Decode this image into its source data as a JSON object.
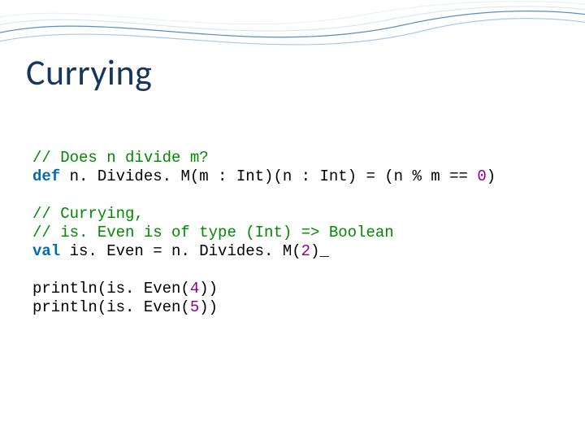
{
  "slide": {
    "title": "Currying",
    "code": {
      "c1_comment": "// Does n divide m?",
      "c1_def": "def",
      "c1_name": " n. Divides. M(m : Int)(n : Int) = (n % m == ",
      "c1_zero": "0",
      "c1_close": ")",
      "c2_comment1": "// Currying,",
      "c2_comment2": "// is. Even is of type (Int) => Boolean",
      "c2_val": "val",
      "c2_assign": " is. Even = n. Divides. M(",
      "c2_two": "2",
      "c2_tail": ")_",
      "c3_l1a": "println(is. Even(",
      "c3_l1b": "4",
      "c3_l1c": "))",
      "c3_l2a": "println(is. Even(",
      "c3_l2b": "5",
      "c3_l2c": "))"
    }
  }
}
